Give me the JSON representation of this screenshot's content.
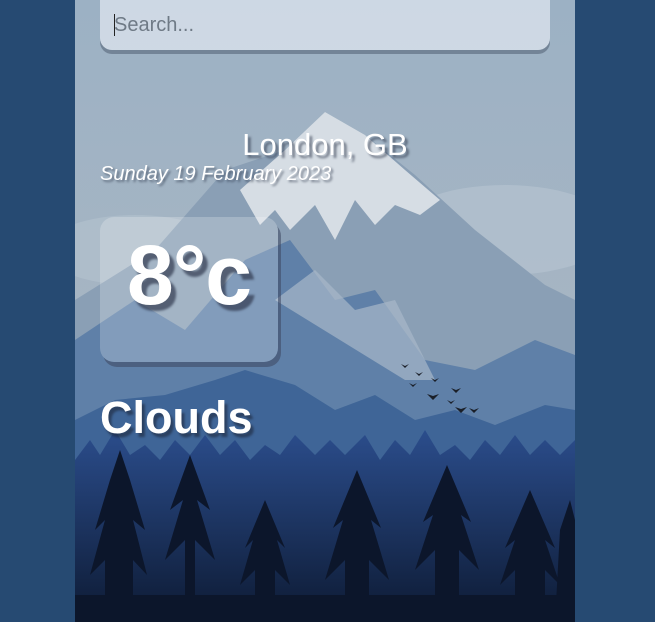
{
  "search": {
    "placeholder": "Search...",
    "value": ""
  },
  "weather": {
    "location": "London, GB",
    "date": "Sunday 19 February 2023",
    "temperature": "8°c",
    "condition": "Clouds"
  },
  "colors": {
    "page_background": "#264a72",
    "text": "#ffffff"
  }
}
